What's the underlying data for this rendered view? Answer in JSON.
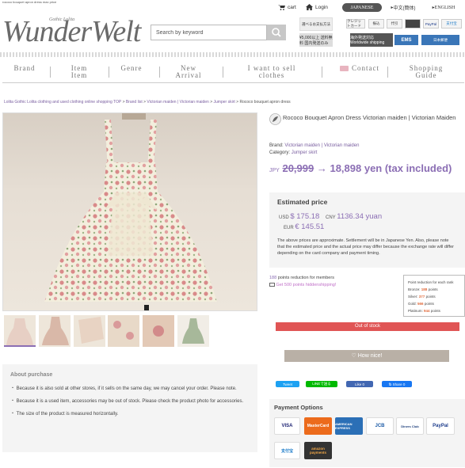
{
  "page_tab": "rococo bouquet apron dress max price",
  "header": {
    "logo_sub": "Gothic Lolita",
    "logo_main": "WunderWelt",
    "search_placeholder": "Search by keyword",
    "cart_label": "cart",
    "login_label": "Login",
    "lang_jp": "JAPANESE",
    "lang_cn": "中文(簡体)",
    "lang_en": "ENGLISH",
    "payment_label": "選べるお支払方法",
    "payment_chips": [
      "クレジットカード",
      "振込",
      "代引",
      "",
      "PayPal",
      "支付宝"
    ],
    "ship_free": "¥5,000以上 送料無料 国内発送のみ",
    "ship_overseas": "海外発送対応 Worldwide shipping",
    "ship_ems": "EMS",
    "ship_japanpost": "日本郵便"
  },
  "nav": [
    {
      "l1": "Brand",
      "l2": ""
    },
    {
      "l1": "Item",
      "l2": "Item"
    },
    {
      "l1": "Genre",
      "l2": ""
    },
    {
      "l1": "New",
      "l2": "Arrival"
    },
    {
      "l1": "I want to sell",
      "l2": "clothes"
    },
    {
      "l1": "Contact",
      "l2": ""
    },
    {
      "l1": "Shopping",
      "l2": "Guide"
    }
  ],
  "breadcrumb": {
    "home": "Lolita Gothic Lolita clothing and used clothing online shopping TOP",
    "brand_list": "Brand list",
    "brand": "Victorian maiden | Victorian maiden",
    "category": "Jumper skirt",
    "current": "Rococo bouquet apron dress"
  },
  "product": {
    "title": "Rococo Bouquet Apron Dress Victorian maiden | Victorian Maiden",
    "brand_label": "Brand:",
    "brand_value": "Victorian maiden | Victorian maiden",
    "category_label": "Category:",
    "category_value": "Jumper skirt",
    "price_prefix": "JPY",
    "price_old": "20,999",
    "price_new": "→ 18,898 yen (tax included)"
  },
  "estimate": {
    "heading": "Estimated price",
    "usd_label": "USD",
    "usd_value": "$ 175.18",
    "cny_label": "CNY",
    "cny_value": "1136.34 yuan",
    "eur_label": "EUR",
    "eur_value": "€ 145.51",
    "note": "The above prices are approximate. Settlement will be in Japanese Yen. Also, please note that the estimated price and the actual price may differ because the exchange rate will differ depending on the card company and payment timing."
  },
  "points": {
    "value": "188",
    "text": "points reduction for members",
    "shipping": "Get 500 points hiddenshipping!",
    "rank_title": "Point reduction for each rank",
    "ranks": [
      {
        "label": "Bronze:",
        "value": "188",
        "unit": "points"
      },
      {
        "label": "Silver:",
        "value": "377",
        "unit": "points"
      },
      {
        "label": "Gold:",
        "value": "566",
        "unit": "points"
      },
      {
        "label": "Platinum:",
        "value": "944",
        "unit": "points"
      }
    ]
  },
  "stock_status": "Out of stock",
  "nice_label": "How nice!",
  "social": {
    "tweet": "Tweet",
    "line": "LINEで送る",
    "like": "Like 0",
    "share": "fb Share 0"
  },
  "payment_options": {
    "heading": "Payment Options",
    "cards": [
      "VISA",
      "MasterCard",
      "AMERICAN EXPRESS",
      "JCB",
      "Diners Club",
      "PayPal",
      "支付宝",
      "amazon payments"
    ]
  },
  "about": {
    "heading": "About purchase",
    "p1": "・ Because it is also sold at other stores, if it sells on the same day, we may cancel your order. Please note.",
    "p2": "・ Because it is a used item, accessories may be out of stock. Please check the product photo for accessories.",
    "p3": "・ The size of the product is measured horizontally."
  },
  "colors": {
    "accent": "#8b6eb4",
    "out_of_stock": "#e05555"
  }
}
